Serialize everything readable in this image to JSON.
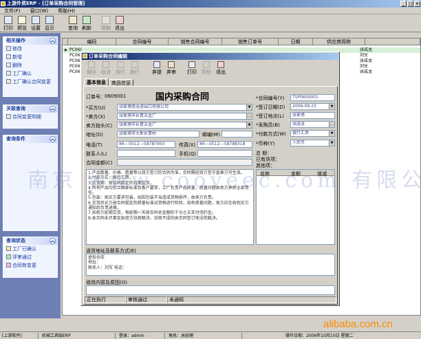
{
  "app": {
    "title": "上游外贸ERP - [订单采购合同管理]",
    "menu": [
      "文件(F)",
      "窗口(W)",
      "帮助(H)"
    ]
  },
  "toolbar": {
    "buttons": [
      "打印",
      "预览",
      "设置",
      "显示",
      "查询",
      "刷新",
      "帮助",
      "退出"
    ]
  },
  "sidebar": {
    "related_ops": {
      "title": "相关操作",
      "items": [
        "修改",
        "新增",
        "删除",
        "工厂确认",
        "工厂确认合同变更"
      ]
    },
    "related_query": {
      "title": "关联查询",
      "items": [
        "合同变更明细"
      ]
    },
    "query_cond": {
      "title": "查询条件"
    },
    "query_status": {
      "title": "查询状态",
      "items": [
        {
          "label": "工厂已确认",
          "color": "#f4e8a0"
        },
        {
          "label": "评审通过",
          "color": "#b8e8b8"
        },
        {
          "label": "合同有变更",
          "color": "#f0b8e8"
        }
      ]
    }
  },
  "grid": {
    "columns": [
      "编码",
      "合同编号",
      "销售合同编号",
      "销售订单号",
      "日期",
      "供应商简称"
    ],
    "rows": [
      {
        "code": "PC060",
        "buyer": "张成龙"
      },
      {
        "code": "PC060",
        "buyer": "刘军"
      },
      {
        "code": "PC060",
        "buyer": "张成龙"
      },
      {
        "code": "PC060",
        "buyer": "刘军"
      },
      {
        "code": "PC060",
        "buyer": "张成龙"
      }
    ]
  },
  "dialog": {
    "title": "订单采购合同编辑",
    "toolbar": [
      "保存",
      "取消",
      "增行",
      "删行",
      "弃提",
      "弃审",
      "打印",
      "帮助",
      "退出"
    ],
    "tabs": [
      "基本信息",
      "商品信息"
    ],
    "order_no_label": "订单号：",
    "order_no": "0609001",
    "heading": "国内采购合同",
    "fields": {
      "buyer_label": "*买方(U)",
      "buyer": "张家港南龙进出口有限公司",
      "seller_label": "*卖方(X)",
      "seller": "张家港市长青五金厂",
      "seller_head_label": "卖方抬头(C)",
      "seller_head": "张家港市长青五金厂",
      "address_label": "地址(D)",
      "address": "张家港市大新长青村",
      "postcode_label": "邮编(M)",
      "phone_label": "电话(T)",
      "phone": "86---0512---58787950",
      "fax_label": "传真(X)",
      "fax": "86---0512---58788318",
      "contact_label": "联系人(L)",
      "mobile_label": "手机(Q)",
      "amount_label": "合同金额(C)",
      "contract_no_label": "*合同编号(Y)",
      "contract_no": "TSP0600001",
      "sign_date_label": "*签订日期(D)",
      "sign_date": "2006-09-23",
      "sign_place_label": "*签订地点(L)",
      "sign_place": "张家港",
      "buyer_staff_label": "*采购员(B)",
      "buyer_staff": "张成龙",
      "payment_label": "*付款方式(W)",
      "payment": "银行汇票",
      "currency_label": "*币种(Y)",
      "currency": "人民币",
      "total_label": "总 额：",
      "goods_label": "已有货项：",
      "other_label": "其他项："
    },
    "terms": "1.产品数量、价格、质量等以双方签订的合同为准，合同需经双方签字盖章方可生效。\n2.付款方式：银行汇票。\n3.交货期：按合同规定的日期交货。\n4.所有产品均符合国家标准及客户要求，工厂负责产品质量，质量问题由卖方承担全部责任。\n5.包装：按买方要求包装，如因包装不当造成货物损坏，由卖方负责。\n6.交货后买方按合同规定的质量标准对货物进行检验，如有质量问题，卖方应在收到买方通知后负责退换。\n7.如卖方延期交货，每延期一天按合同总金额的千分之五支付违约金。\n8.本合同未尽事宜由双方协商解决，协商不成的由合同签订地法院裁决。",
    "sub_grid_cols": [
      "名称",
      "金额",
      "增减"
    ],
    "delivery_label": "送货地址及联系方式(E)",
    "delivery_text": "虚拟仓库\n地址：\n联系人：刘军 电话：",
    "modify_label": "修改内容及原因(O)",
    "status": [
      "正在执行",
      "审核通过",
      "未通知"
    ]
  },
  "statusbar": {
    "items": [
      "[上游软件]",
      "机械工具版ERP",
      "登录：admin",
      "角色：总经理",
      "操作日期：2006年10月10日 星期二"
    ]
  },
  "watermark": "南京 www.cooveec.com 有限公司",
  "brand": "alibaba.com.cn"
}
